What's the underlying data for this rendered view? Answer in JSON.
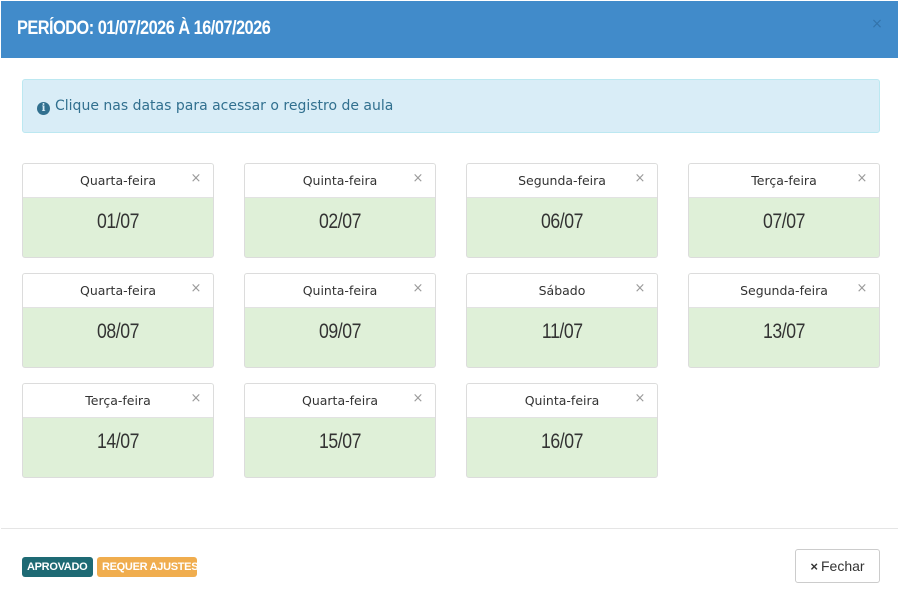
{
  "modal": {
    "title": "PERÍODO: 01/07/2026 À 16/07/2026",
    "close_icon": "×"
  },
  "alert": {
    "icon": "info-circle-icon",
    "icon_glyph": "i",
    "text": "Clique nas datas para acessar o registro de aula"
  },
  "colors": {
    "header_bg": "#418bca",
    "card_body_bg": "#dff0d8",
    "alert_bg": "#d9edf7",
    "approved_badge": "#1e6a74",
    "adjust_badge": "#f0ad4e"
  },
  "cards": [
    {
      "weekday": "Quarta-feira",
      "date": "01/07"
    },
    {
      "weekday": "Quinta-feira",
      "date": "02/07"
    },
    {
      "weekday": "Segunda-feira",
      "date": "06/07"
    },
    {
      "weekday": "Terça-feira",
      "date": "07/07"
    },
    {
      "weekday": "Quarta-feira",
      "date": "08/07"
    },
    {
      "weekday": "Quinta-feira",
      "date": "09/07"
    },
    {
      "weekday": "Sábado",
      "date": "11/07"
    },
    {
      "weekday": "Segunda-feira",
      "date": "13/07"
    },
    {
      "weekday": "Terça-feira",
      "date": "14/07"
    },
    {
      "weekday": "Quarta-feira",
      "date": "15/07"
    },
    {
      "weekday": "Quinta-feira",
      "date": "16/07"
    }
  ],
  "card_remove_icon": "×",
  "footer": {
    "badges": {
      "approved": "APROVADO",
      "adjust": "REQUER AJUSTES"
    },
    "close_button": {
      "icon": "×",
      "label": "Fechar"
    }
  }
}
